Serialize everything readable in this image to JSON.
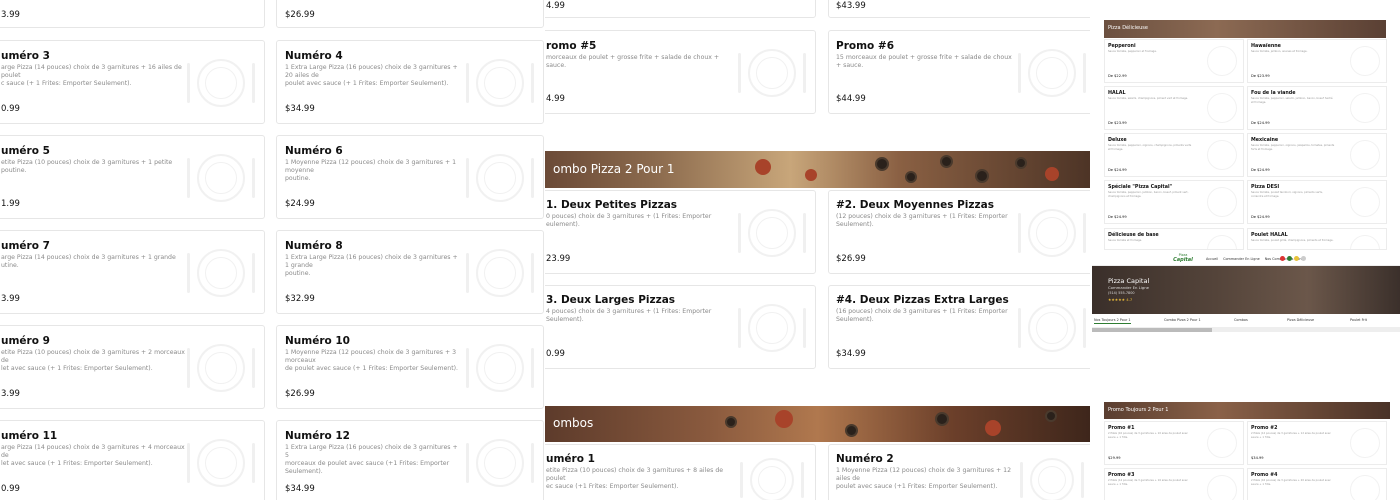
{
  "panel1": {
    "top_price_left": "3.99",
    "top_price_right": "$26.99",
    "cards": [
      {
        "title": "uméro 3",
        "desc": "arge Pizza (14 pouces) choix de 3 garnitures + 16 ailes de poulet\nc sauce (+ 1 Frites: Emporter Seulement).",
        "price": "0.99"
      },
      {
        "title": "Numéro 4",
        "desc": "1 Extra Large Pizza (16 pouces) choix de 3 garnitures + 20 ailes de\npoulet avec sauce (+ 1 Frites: Emporter Seulement).",
        "price": "$34.99"
      },
      {
        "title": "uméro 5",
        "desc": "etite Pizza (10 pouces) choix de 3 garnitures + 1 petite poutine.",
        "price": "1.99"
      },
      {
        "title": "Numéro 6",
        "desc": "1 Moyenne Pizza (12 pouces) choix de 3 garnitures + 1 moyenne\npoutine.",
        "price": "$24.99"
      },
      {
        "title": "uméro 7",
        "desc": "arge Pizza (14 pouces) choix de 3 garnitures + 1 grande\nutine.",
        "price": "3.99"
      },
      {
        "title": "Numéro 8",
        "desc": "1 Extra Large Pizza (16 pouces) choix de 3 garnitures + 1 grande\npoutine.",
        "price": "$32.99"
      },
      {
        "title": "uméro 9",
        "desc": "etite Pizza (10 pouces) choix de 3 garnitures + 2 morceaux de\nlet avec sauce (+ 1 Frites: Emporter Seulement).",
        "price": "3.99"
      },
      {
        "title": "Numéro 10",
        "desc": "1 Moyenne Pizza (12 pouces) choix de 3 garnitures + 3 morceaux\nde poulet avec sauce (+ 1 Frites: Emporter Seulement).",
        "price": "$26.99"
      },
      {
        "title": "uméro 11",
        "desc": "arge Pizza (14 pouces) choix de 3 garnitures + 4 morceaux de\nlet avec sauce (+ 1 Frites: Emporter Seulement).",
        "price": "0.99"
      },
      {
        "title": "Numéro 12",
        "desc": "1 Extra Large Pizza (16 pouces) choix de 3 garnitures + 5\nmorceaux de poulet avec sauce (+1 Frites: Emporter Seulement).",
        "price": "$34.99"
      }
    ]
  },
  "panel2": {
    "top_price_left": "4.99",
    "top_price_right": "$43.99",
    "promos": [
      {
        "title": "romo #5",
        "desc": "morceaux de poulet + grosse frite + salade de choux + sauce.",
        "price": "4.99"
      },
      {
        "title": "Promo #6",
        "desc": "15 morceaux de poulet + grosse frite + salade de choux + sauce.",
        "price": "$44.99"
      }
    ],
    "banner1": "ombo Pizza 2 Pour 1",
    "combos": [
      {
        "title": "1. Deux Petites Pizzas",
        "desc": "0 pouces) choix de 3 garnitures + (1 Frites: Emporter\neulement).",
        "price": "23.99"
      },
      {
        "title": "#2. Deux Moyennes Pizzas",
        "desc": "(12 pouces) choix de 3 garnitures + (1 Frites: Emporter Seulement).",
        "price": "$26.99"
      },
      {
        "title": "3. Deux Larges Pizzas",
        "desc": "4 pouces) choix de 3 garnitures + (1 Frites: Emporter Seulement).",
        "price": "0.99"
      },
      {
        "title": "#4. Deux Pizzas Extra Larges",
        "desc": "(16 pouces) choix de 3 garnitures + (1 Frites: Emporter Seulement).",
        "price": "$34.99"
      }
    ],
    "banner2": "ombos",
    "bottom": [
      {
        "title": "uméro 1",
        "desc": "etite Pizza (10 pouces) choix de 3 garnitures + 8 ailes de poulet\nec sauce (+1 Frites: Emporter Seulement)."
      },
      {
        "title": "Numéro 2",
        "desc": "1 Moyenne Pizza (12 pouces) choix de 3 garnitures + 12 ailes de\npoulet avec sauce (+1 Frites: Emporter Seulement)."
      }
    ]
  },
  "panel3": {
    "section_title": "Pizza Délicieuse",
    "items": [
      {
        "title": "Pepperoni",
        "desc": "Sauce tomate, pepperoni et fromage.",
        "price": "De $22.99"
      },
      {
        "title": "Hawaïenne",
        "desc": "Sauce tomate, jambon, ananas et fromage.",
        "price": "De $23.99"
      },
      {
        "title": "HALAL",
        "desc": "Sauce tomate, salami, champignons, piment vert et fromage.",
        "price": "De $23.99"
      },
      {
        "title": "Fou de la viande",
        "desc": "Sauce tomate, pepperoni, salami, jambon, bacon, boeuf haché et fromage.",
        "price": "De $24.99"
      },
      {
        "title": "Deluxe",
        "desc": "Sauce tomate, pepperoni, oignons, champignons, piments verts et fromage.",
        "price": "De $24.99"
      },
      {
        "title": "Mexicaine",
        "desc": "Sauce tomate, pepperoni, oignons, jalapeños, tomates, piments forts et fromage.",
        "price": "De $24.99"
      },
      {
        "title": "Spéciale \"Pizza Capital\"",
        "desc": "Sauce tomate, pepperoni, jambon, bacon, boeuf, piment vert, champignons et fromage.",
        "price": "De $24.99"
      },
      {
        "title": "Pizza DESI",
        "desc": "Sauce tomate, poulet tandoori, oignons, piments verts, coriandre et fromage.",
        "price": "De $24.99"
      },
      {
        "title": "Délicieuse de base",
        "desc": "Sauce tomate et fromage.",
        "price": ""
      },
      {
        "title": "Poulet HALAL",
        "desc": "Sauce tomate, poulet grillé, champignons, piments et fromage.",
        "price": ""
      }
    ],
    "restaurant": {
      "logo_line1": "Pizza",
      "logo_line2": "Capital",
      "name": "Pizza Capital",
      "subtitle": "Commander En Ligne",
      "phone": "(514) 555-7800",
      "rating": "★★★★★  4.7",
      "topnav": [
        "Accueil",
        "Commander En Ligne",
        "Nos Commandes",
        "Info"
      ]
    },
    "tabs": [
      "Nos Toujours 2 Pour 1",
      "Combo Pizza 2 Pour 1",
      "Combos",
      "Pizza Délicieuse",
      "Poulet Frit"
    ],
    "promo_title": "Promo Toujours 2 Pour 1",
    "promos": [
      {
        "title": "Promo #1",
        "desc": "2 Pizza (10 pouces) de 3 garnitures + 10 ailes de poulet avec sauce + 1 frite.",
        "price": "$29.99"
      },
      {
        "title": "Promo #2",
        "desc": "2 Pizza (12 pouces) de 3 garnitures + 12 ailes de poulet avec sauce + 1 frite.",
        "price": "$34.99"
      },
      {
        "title": "Promo #3",
        "desc": "2 Pizza (14 pouces) de 3 garnitures + 16 ailes de poulet avec sauce + 1 frite.",
        "price": ""
      },
      {
        "title": "Promo #4",
        "desc": "2 Pizza (16 pouces) de 3 garnitures + 20 ailes de poulet avec sauce + 1 frite.",
        "price": ""
      }
    ],
    "colors": {
      "banner": "#5a4336",
      "accent": "#2e7d32"
    }
  }
}
